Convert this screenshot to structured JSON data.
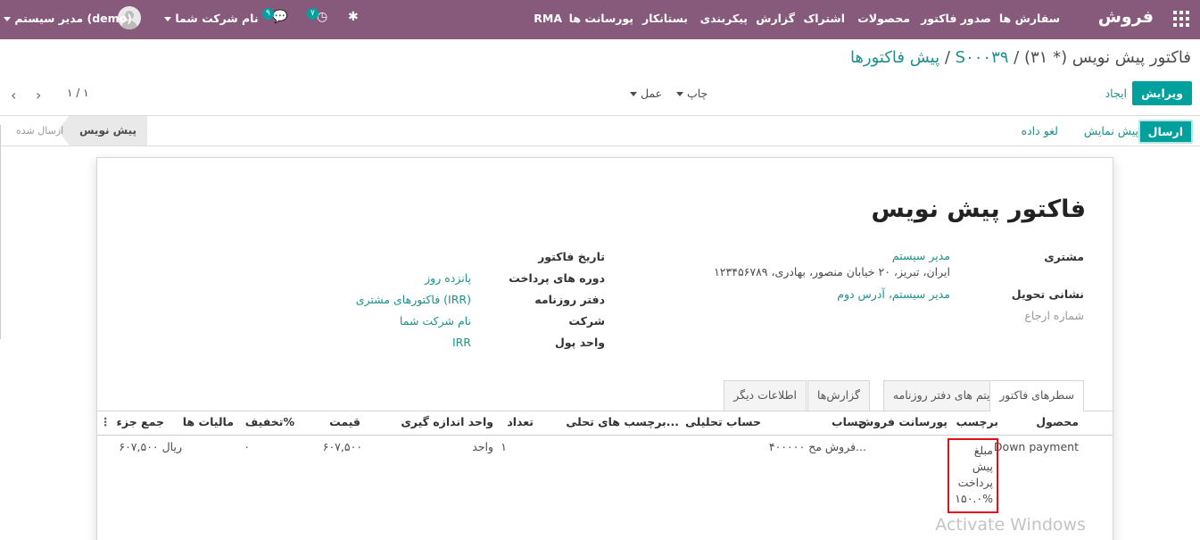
{
  "nav": {
    "brand": "فروش",
    "menu": [
      "سفارش ها",
      "صدور فاکتور",
      "محصولات",
      "اشتراک",
      "گزارش",
      "پیکربندی",
      "بستانکار",
      "پورسانت ها",
      "RMA"
    ],
    "messages_badge": "۹",
    "activities_badge": "۷",
    "company": "نام شرکت شما",
    "user": "مدیر سیستم (demo)"
  },
  "breadcrumb": {
    "root": "پیش فاکتورها",
    "separator": "/",
    "order": "S۰۰۰۳۹",
    "current": "فاکتور پیش نویس (* ۳۱)"
  },
  "actions": {
    "edit": "ویرایش",
    "create": "ایجاد",
    "print": "چاپ",
    "action": "عمل",
    "pager": "۱ / ۱"
  },
  "statusbar": {
    "send": "ارسال",
    "preview": "پیش نمایش",
    "reset": "لغو داده",
    "active_state": "پیش نویس",
    "inactive_state": "ارسال شده"
  },
  "doc": {
    "title": "فاکتور پیش نویس",
    "customer_label": "مشتری",
    "customer_name": "مدیر سیستم",
    "customer_address": "ایران، تبریز، ۲۰ خیابان منصور، بهادری، ۱۲۳۴۵۶۷۸۹",
    "delivery_label": "نشانی تحویل",
    "delivery_value": "مدیر سیستم، آدرس دوم",
    "reference_label": "شماره ارجاع",
    "invoice_date_label": "تاریخ فاکتور",
    "payment_terms_label": "دوره های پرداخت",
    "payment_terms_value": "پانزده روز",
    "journal_label": "دفتر روزنامه",
    "journal_value": "فاکتورهای مشتری (IRR)",
    "company_label": "شرکت",
    "company_value": "نام شرکت شما",
    "currency_label": "واحد پول",
    "currency_value": "IRR"
  },
  "tabs": [
    "سطرهای فاکتور",
    "آیتم های دفتر روزنامه",
    "گزارش‌ها",
    "اطلاعات دیگر"
  ],
  "table": {
    "headers": {
      "product": "محصول",
      "label": "برچسب",
      "commission": "پورسانت فروش",
      "account": "حساب",
      "analytic_account": "حساب تحلیلی",
      "analytic_tags": "برچسب های تحلی...",
      "quantity": "تعداد",
      "uom": "واحد اندازه گیری",
      "price": "قیمت",
      "discount": "تخفیف%",
      "taxes": "مالیات ها",
      "subtotal": "جمع جزء"
    },
    "row": {
      "product": "Down payment",
      "label": "مبلغ پیش پرداخت %۱۵۰.۰",
      "account": "۴۰۰۰۰۰ فروش مح...",
      "quantity": "۱",
      "uom": "واحد",
      "price": "۶۰۷,۵۰۰",
      "discount": "۰",
      "subtotal": "۶۰۷,۵۰۰ ریال"
    }
  },
  "watermark": "Activate Windows"
}
